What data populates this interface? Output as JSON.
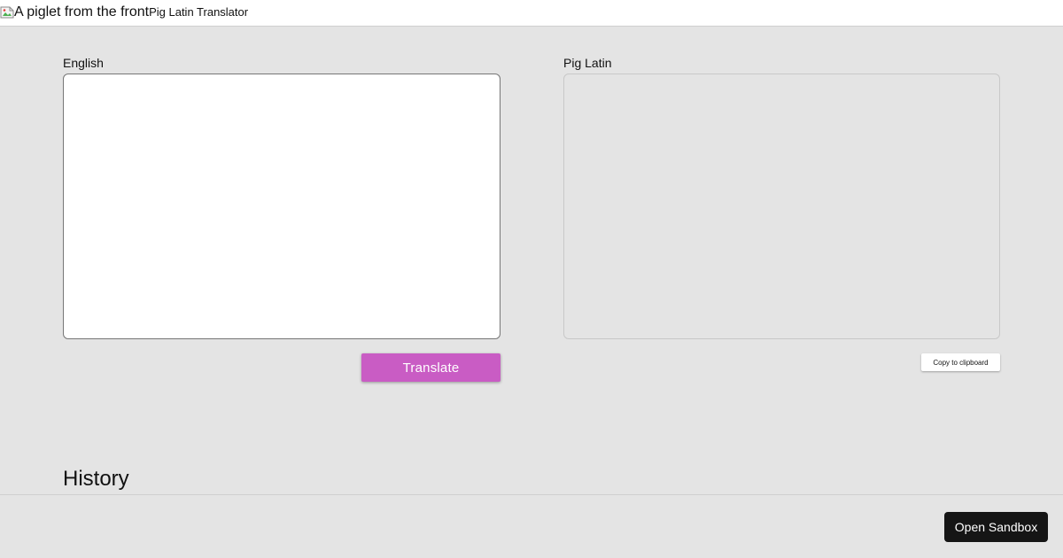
{
  "header": {
    "logo_alt": "A piglet from the front",
    "logo_icon": "broken-image-icon",
    "title": "Pig Latin Translator"
  },
  "english": {
    "label": "English",
    "value": "",
    "placeholder": ""
  },
  "pig_latin": {
    "label": "Pig Latin",
    "value": "",
    "placeholder": ""
  },
  "buttons": {
    "translate_label": "Translate",
    "copy_label": "Copy to clipboard",
    "sandbox_label": "Open Sandbox"
  },
  "history": {
    "heading": "History"
  },
  "colors": {
    "accent": "#c95cc4",
    "background": "#e4e4e4",
    "sandbox_button": "#151515"
  }
}
